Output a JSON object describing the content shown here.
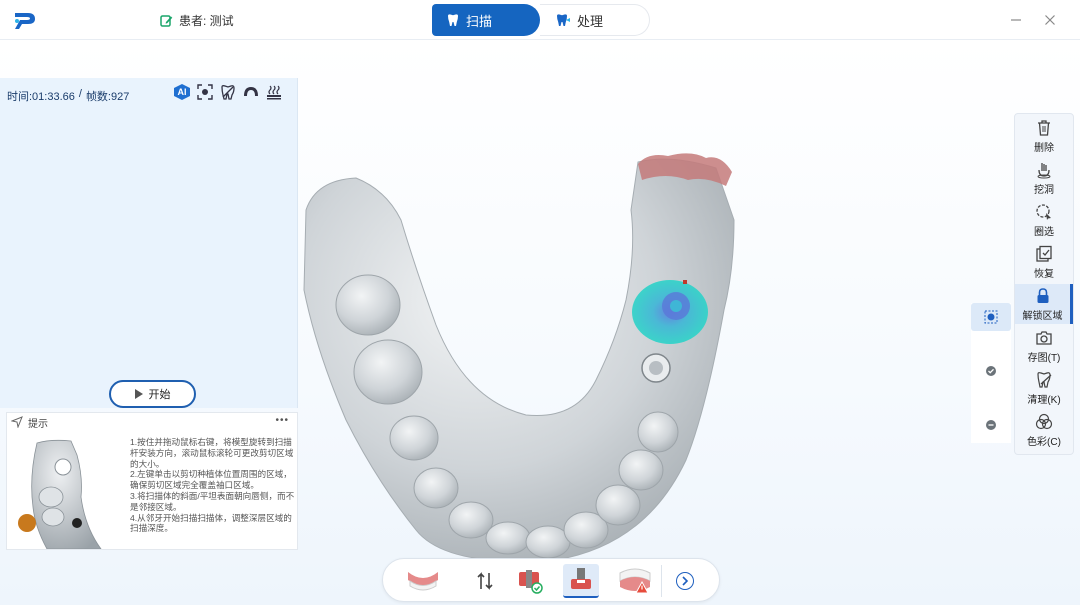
{
  "header": {
    "patient_label": "患者: 测试",
    "tabs": [
      {
        "label": "扫描",
        "active": true
      },
      {
        "label": "处理",
        "active": false
      }
    ]
  },
  "scan_panel": {
    "time_label": "时间:01:33.66",
    "separator": "/",
    "frames_label": "帧数:927",
    "ai_badge": "AI",
    "tool_icons": [
      "ai-icon",
      "focus-frame-icon",
      "tooth-brush-icon",
      "jaw-scan-icon",
      "heat-icon"
    ],
    "start_label": "开始"
  },
  "hint": {
    "title": "提示",
    "more": "•••",
    "lines": [
      "1.按住并拖动鼠标右键，将模型旋转到扫描杆安装方向，滚动鼠标滚轮可更改剪切区域的大小。",
      "2.左键单击以剪切种植体位置周围的区域，确保剪切区域完全覆盖袖口区域。",
      "3.将扫描体的斜面/平坦表面朝向唇侧，而不是邻接区域。",
      "4.从邻牙开始扫描扫描体，调整深层区域的扫描深度。"
    ]
  },
  "right_toolbar": {
    "items": [
      {
        "label": "删除",
        "icon": "trash-icon"
      },
      {
        "label": "挖洞",
        "icon": "dig-hole-icon"
      },
      {
        "label": "圈选",
        "icon": "lasso-select-icon"
      },
      {
        "label": "恢复",
        "icon": "restore-icon"
      },
      {
        "label": "解锁区域",
        "icon": "lock-icon",
        "active": true
      },
      {
        "label": "存图(T)",
        "icon": "camera-icon"
      },
      {
        "label": "清理(K)",
        "icon": "clean-icon"
      },
      {
        "label": "色彩(C)",
        "icon": "color-icon"
      }
    ]
  },
  "colors": {
    "accent": "#1565c0",
    "panel_bg": "#e9f3fd",
    "scan_highlight": "#2fd3c8",
    "gingiva": "#c47a7a",
    "model_gray": "#cfd4d8"
  }
}
